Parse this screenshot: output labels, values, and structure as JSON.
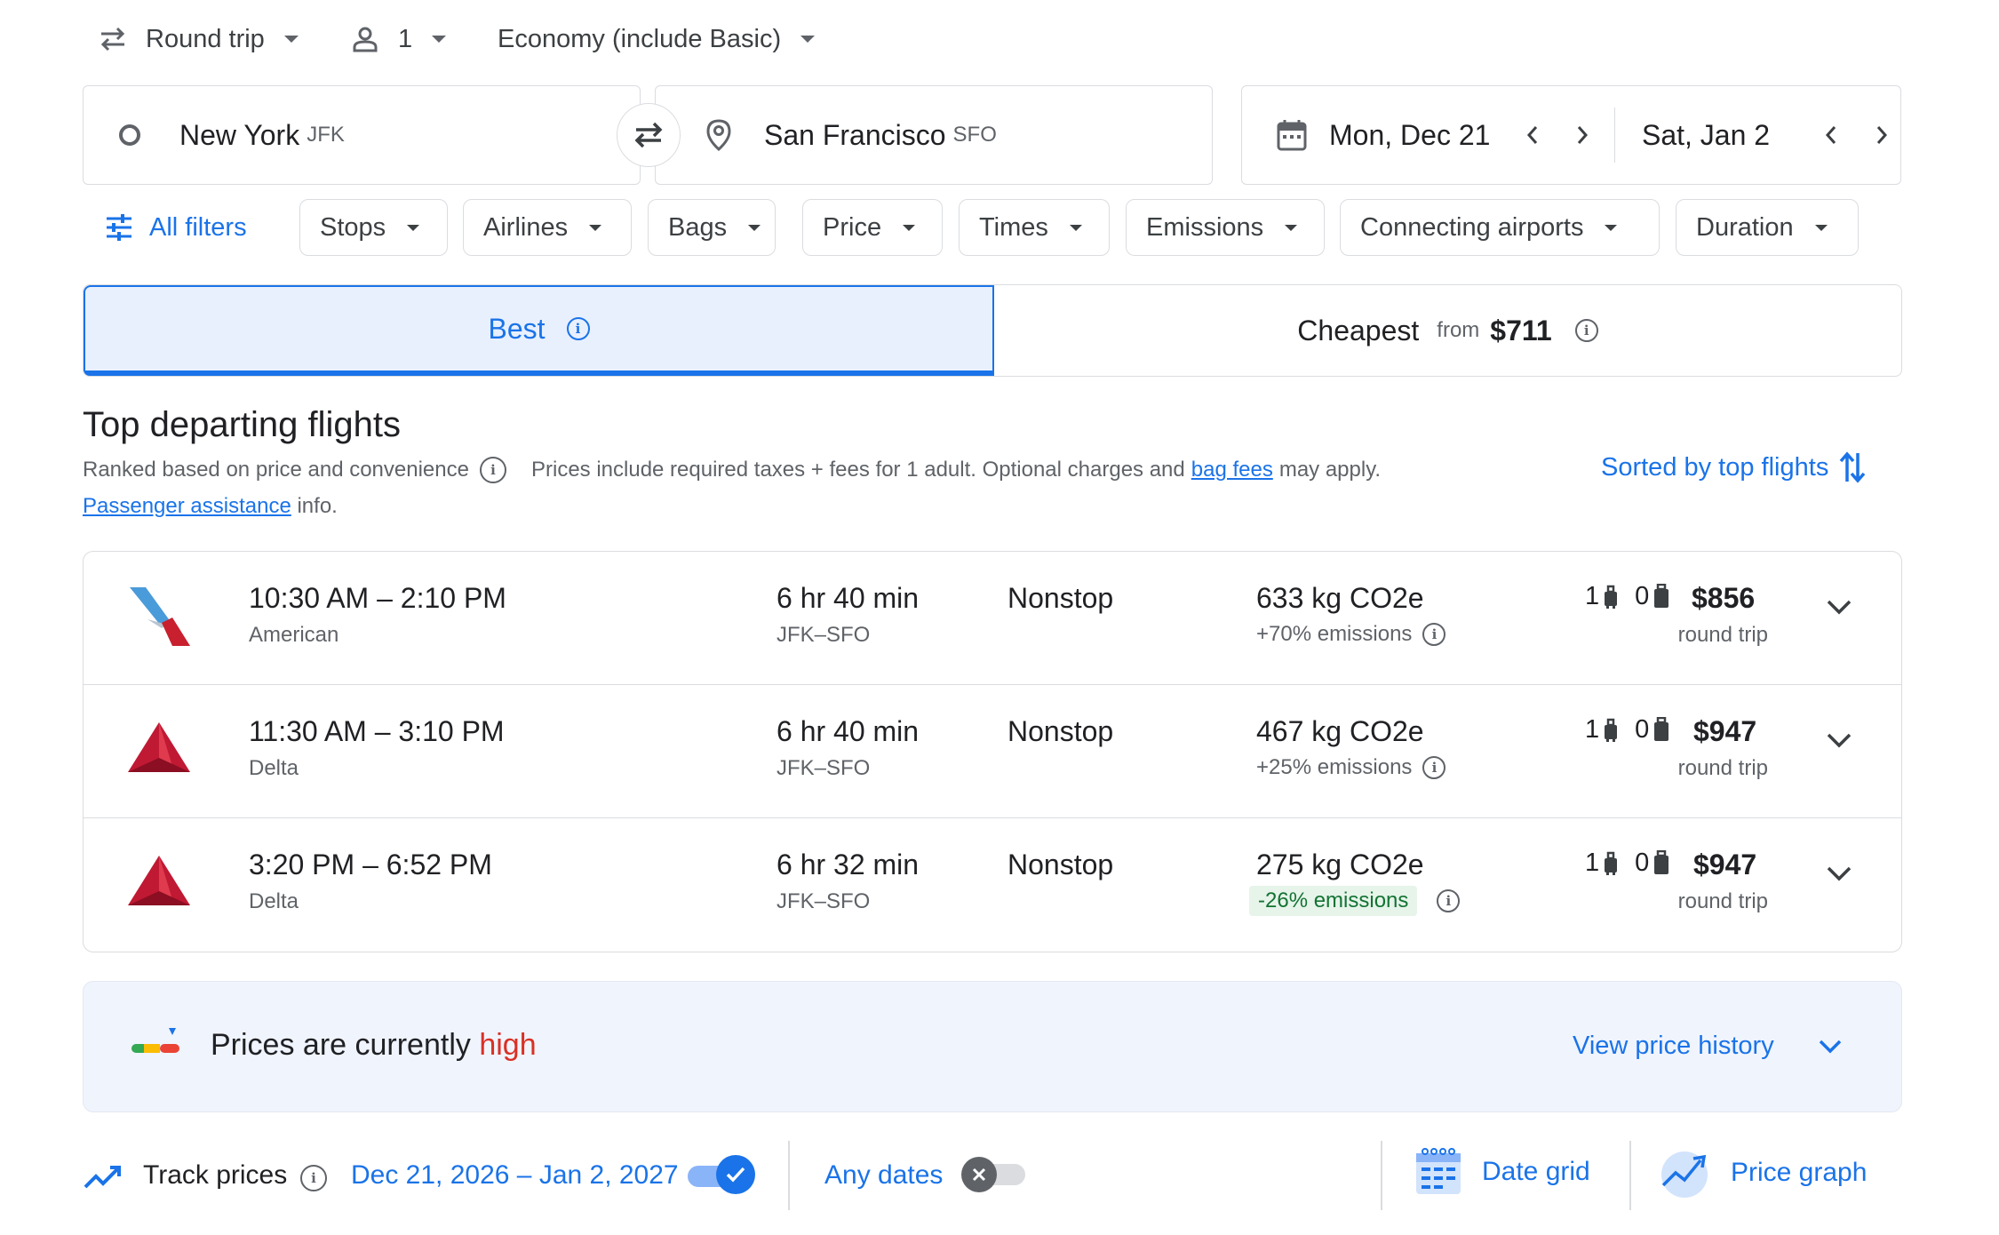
{
  "top_bar": {
    "trip_type": "Round trip",
    "passengers": "1",
    "cabin": "Economy (include Basic)"
  },
  "search": {
    "origin_city": "New York",
    "origin_code": "JFK",
    "destination_city": "San Francisco",
    "destination_code": "SFO",
    "depart_date": "Mon, Dec 21",
    "return_date": "Sat, Jan 2"
  },
  "filters": {
    "all_filters": "All filters",
    "chips": [
      "Stops",
      "Airlines",
      "Bags",
      "Price",
      "Times",
      "Emissions",
      "Connecting airports",
      "Duration"
    ]
  },
  "tabs": {
    "best": "Best",
    "cheapest": "Cheapest",
    "cheapest_from": "from",
    "cheapest_price": "$711"
  },
  "section": {
    "title": "Top departing flights",
    "ranked": "Ranked based on price and convenience",
    "prices_note": "Prices include required taxes + fees for 1 adult. Optional charges and",
    "bag_fees": "bag fees",
    "may_apply": "may apply.",
    "passenger_assistance": "Passenger assistance",
    "info": "info.",
    "sort_label": "Sorted by top flights"
  },
  "flights": [
    {
      "times": "10:30 AM – 2:10 PM",
      "airline": "American",
      "duration": "6 hr 40 min",
      "route": "JFK–SFO",
      "stops": "Nonstop",
      "co2": "633 kg CO2e",
      "emissions": "+70% emissions",
      "carry_on": "1",
      "checked": "0",
      "price": "$856",
      "trip": "round trip",
      "logo": "american-airlines-logo"
    },
    {
      "times": "11:30 AM – 3:10 PM",
      "airline": "Delta",
      "duration": "6 hr 40 min",
      "route": "JFK–SFO",
      "stops": "Nonstop",
      "co2": "467 kg CO2e",
      "emissions": "+25% emissions",
      "carry_on": "1",
      "checked": "0",
      "price": "$947",
      "trip": "round trip",
      "logo": "delta-logo"
    },
    {
      "times": "3:20 PM – 6:52 PM",
      "airline": "Delta",
      "duration": "6 hr 32 min",
      "route": "JFK–SFO",
      "stops": "Nonstop",
      "co2": "275 kg CO2e",
      "emissions": "-26% emissions",
      "carry_on": "1",
      "checked": "0",
      "price": "$947",
      "trip": "round trip",
      "logo": "delta-logo"
    }
  ],
  "price_insight": {
    "prefix": "Prices are currently",
    "level": "high",
    "level_color": "#d93025",
    "view_history": "View price history"
  },
  "tracking": {
    "label": "Track prices",
    "dates": "Dec 21, 2026 – Jan 2, 2027",
    "track_dates_on": true,
    "any_dates": "Any dates",
    "any_dates_on": false,
    "date_grid": "Date grid",
    "price_graph": "Price graph"
  },
  "colors": {
    "accent": "#1a73e8",
    "positive": "#137333",
    "warning": "#d93025"
  }
}
